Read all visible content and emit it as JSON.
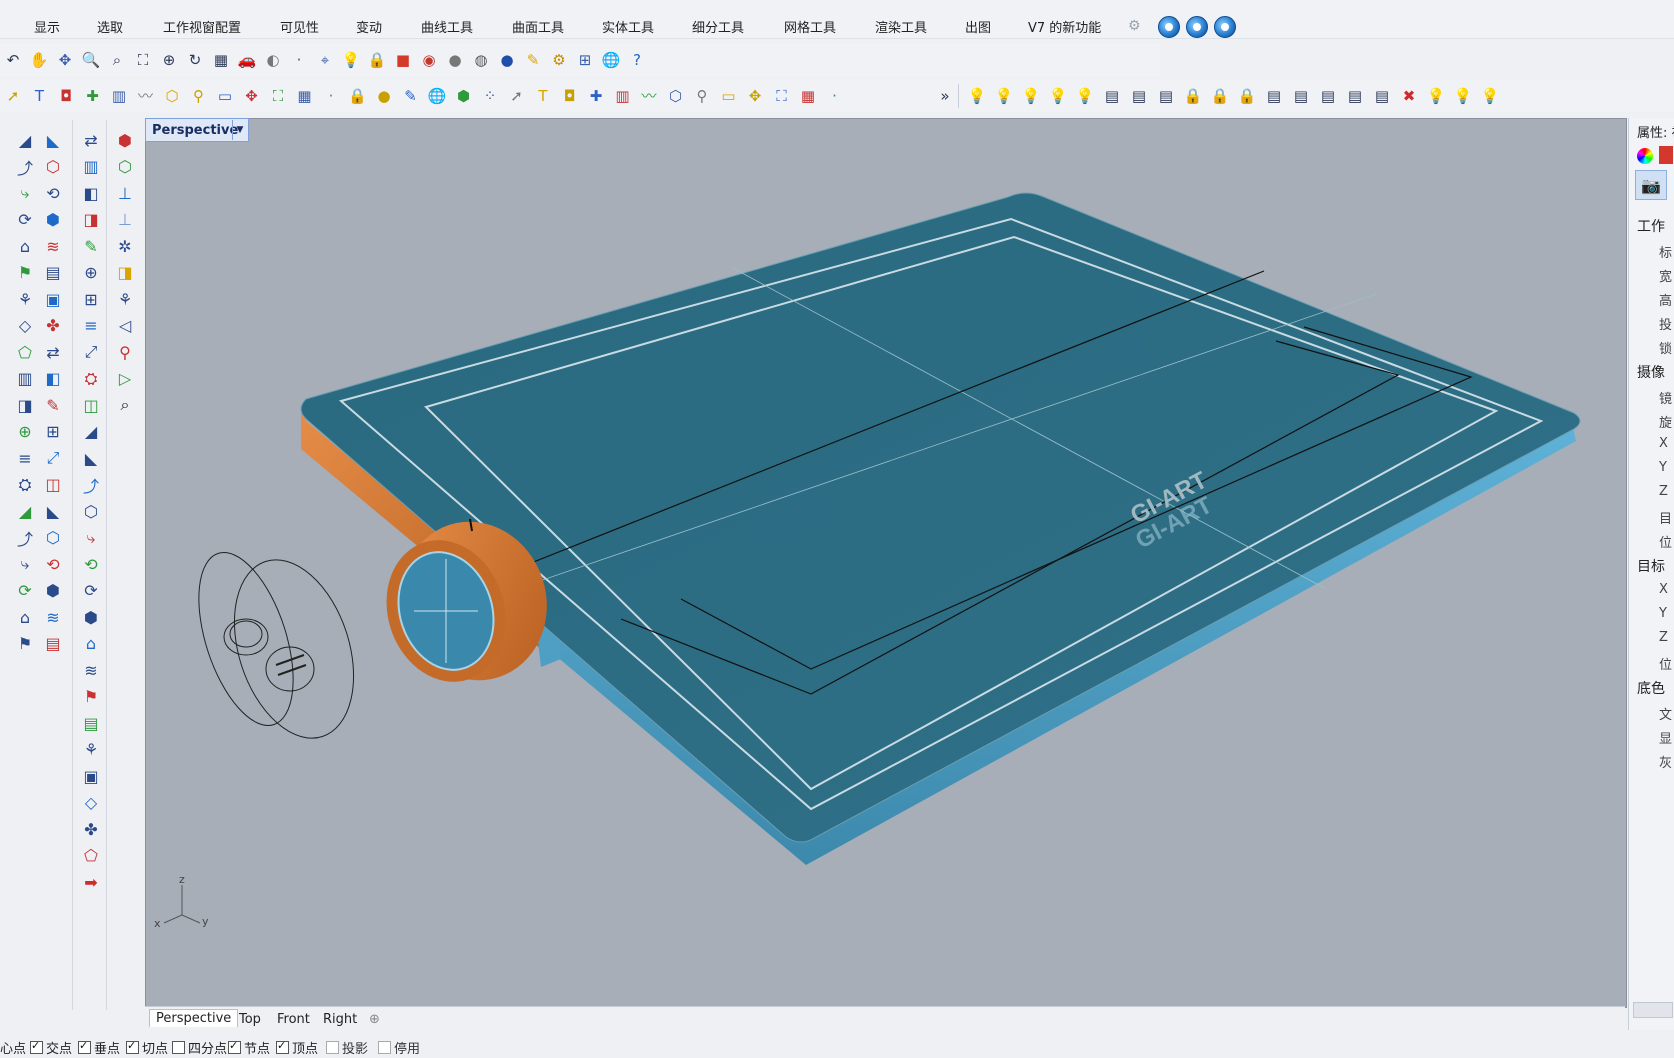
{
  "menu": {
    "items": [
      "显示",
      "选取",
      "工作视窗配置",
      "可见性",
      "变动",
      "曲线工具",
      "曲面工具",
      "实体工具",
      "细分工具",
      "网格工具",
      "渲染工具",
      "出图",
      "V7 的新功能"
    ]
  },
  "toolbar1_icons": [
    "undo-icon",
    "pan-hand-icon",
    "rotate-view-icon",
    "zoom-icon",
    "zoom-window-icon",
    "zoom-extents-icon",
    "zoom-selected-icon",
    "rotate-camera-icon",
    "four-viewports-icon",
    "car-icon",
    "shade-icon",
    "point-icon",
    "cplane-icon",
    "light-icon",
    "lock-icon",
    "properties-icon",
    "color-wheel-icon",
    "sphere-icon",
    "sphere-shaded-icon",
    "sphere-render-icon",
    "highlighter-icon",
    "gear-settings-icon",
    "snap-grid-icon",
    "globe-icon",
    "help-icon"
  ],
  "toolbar2_icons": [
    "3d-text-icon",
    "box-icon",
    "colors-icon",
    "layer-icon",
    "points-icon",
    "cloud-icon",
    "group-icon",
    "select-icon",
    "hatch-icon",
    "dimension-icon",
    "text-icon",
    "tag-icon",
    "block-icon",
    "material-icon",
    "sphere-black-icon",
    "extrude-icon",
    "move-icon",
    "plane-icon",
    "layout-icon",
    "wood-icon",
    "spiral-icon",
    "sweep-icon",
    "curve-icon",
    "solid-icon",
    "sphere-wire-icon",
    "cube-icon",
    "explode-icon",
    "paint-icon",
    "magnifier-icon",
    "array-icon",
    "render-icon",
    "ticket-icon"
  ],
  "toolbar2_more": "»",
  "toolbar3_icons": [
    "bulb-icon",
    "bulb2-icon",
    "bulb3-icon",
    "bulb4-icon",
    "bulb5-icon",
    "layer-page-icon",
    "layer-page2-icon",
    "layer-page3-icon",
    "lock-icon",
    "unlock-icon",
    "lock2-icon",
    "layer-swap-icon",
    "layer-swap2-icon",
    "select-all-icon",
    "select-grid-icon",
    "isolate-icon",
    "delete-icon",
    "bulb-hide-icon",
    "bulb-show-icon",
    "bulb-off-icon"
  ],
  "render_icons": [
    "render-icon",
    "render-settings-icon",
    "render-preview-icon"
  ],
  "viewport": {
    "title": "Perspective",
    "logo_text": "GI-ART",
    "axis": {
      "x": "x",
      "y": "y",
      "z": "z"
    }
  },
  "tabs": [
    "Perspective",
    "Top",
    "Front",
    "Right"
  ],
  "tab_add": "⊕",
  "status": {
    "snaps": [
      {
        "label": "心点",
        "checked": null
      },
      {
        "label": "交点",
        "checked": true
      },
      {
        "label": "垂点",
        "checked": true
      },
      {
        "label": "切点",
        "checked": true
      },
      {
        "label": "四分点",
        "checked": false
      },
      {
        "label": "节点",
        "checked": true
      },
      {
        "label": "顶点",
        "checked": true
      },
      {
        "label": "投影",
        "checked": false
      },
      {
        "label": "停用",
        "checked": false
      }
    ]
  },
  "right_panel": {
    "title": "属性: 视",
    "section_work": "工作",
    "work_rows": [
      "标",
      "宽",
      "高",
      "投",
      "锁"
    ],
    "section_camera": "摄像",
    "camera_rows": [
      "镜",
      "旋",
      "X",
      "Y",
      "Z",
      "目",
      "位"
    ],
    "section_target": "目标",
    "target_rows": [
      "X",
      "Y",
      "Z",
      "位"
    ],
    "section_bg": "底色",
    "bg_rows": [
      "文",
      "显",
      "灰"
    ]
  },
  "colors": {
    "viewport_bg": "#a7aeb8",
    "tablet_top": "#2e6f86",
    "tablet_side": "#4f9ec3",
    "dial_orange": "#d97a32",
    "accent_blue": "#7fa0d8"
  }
}
